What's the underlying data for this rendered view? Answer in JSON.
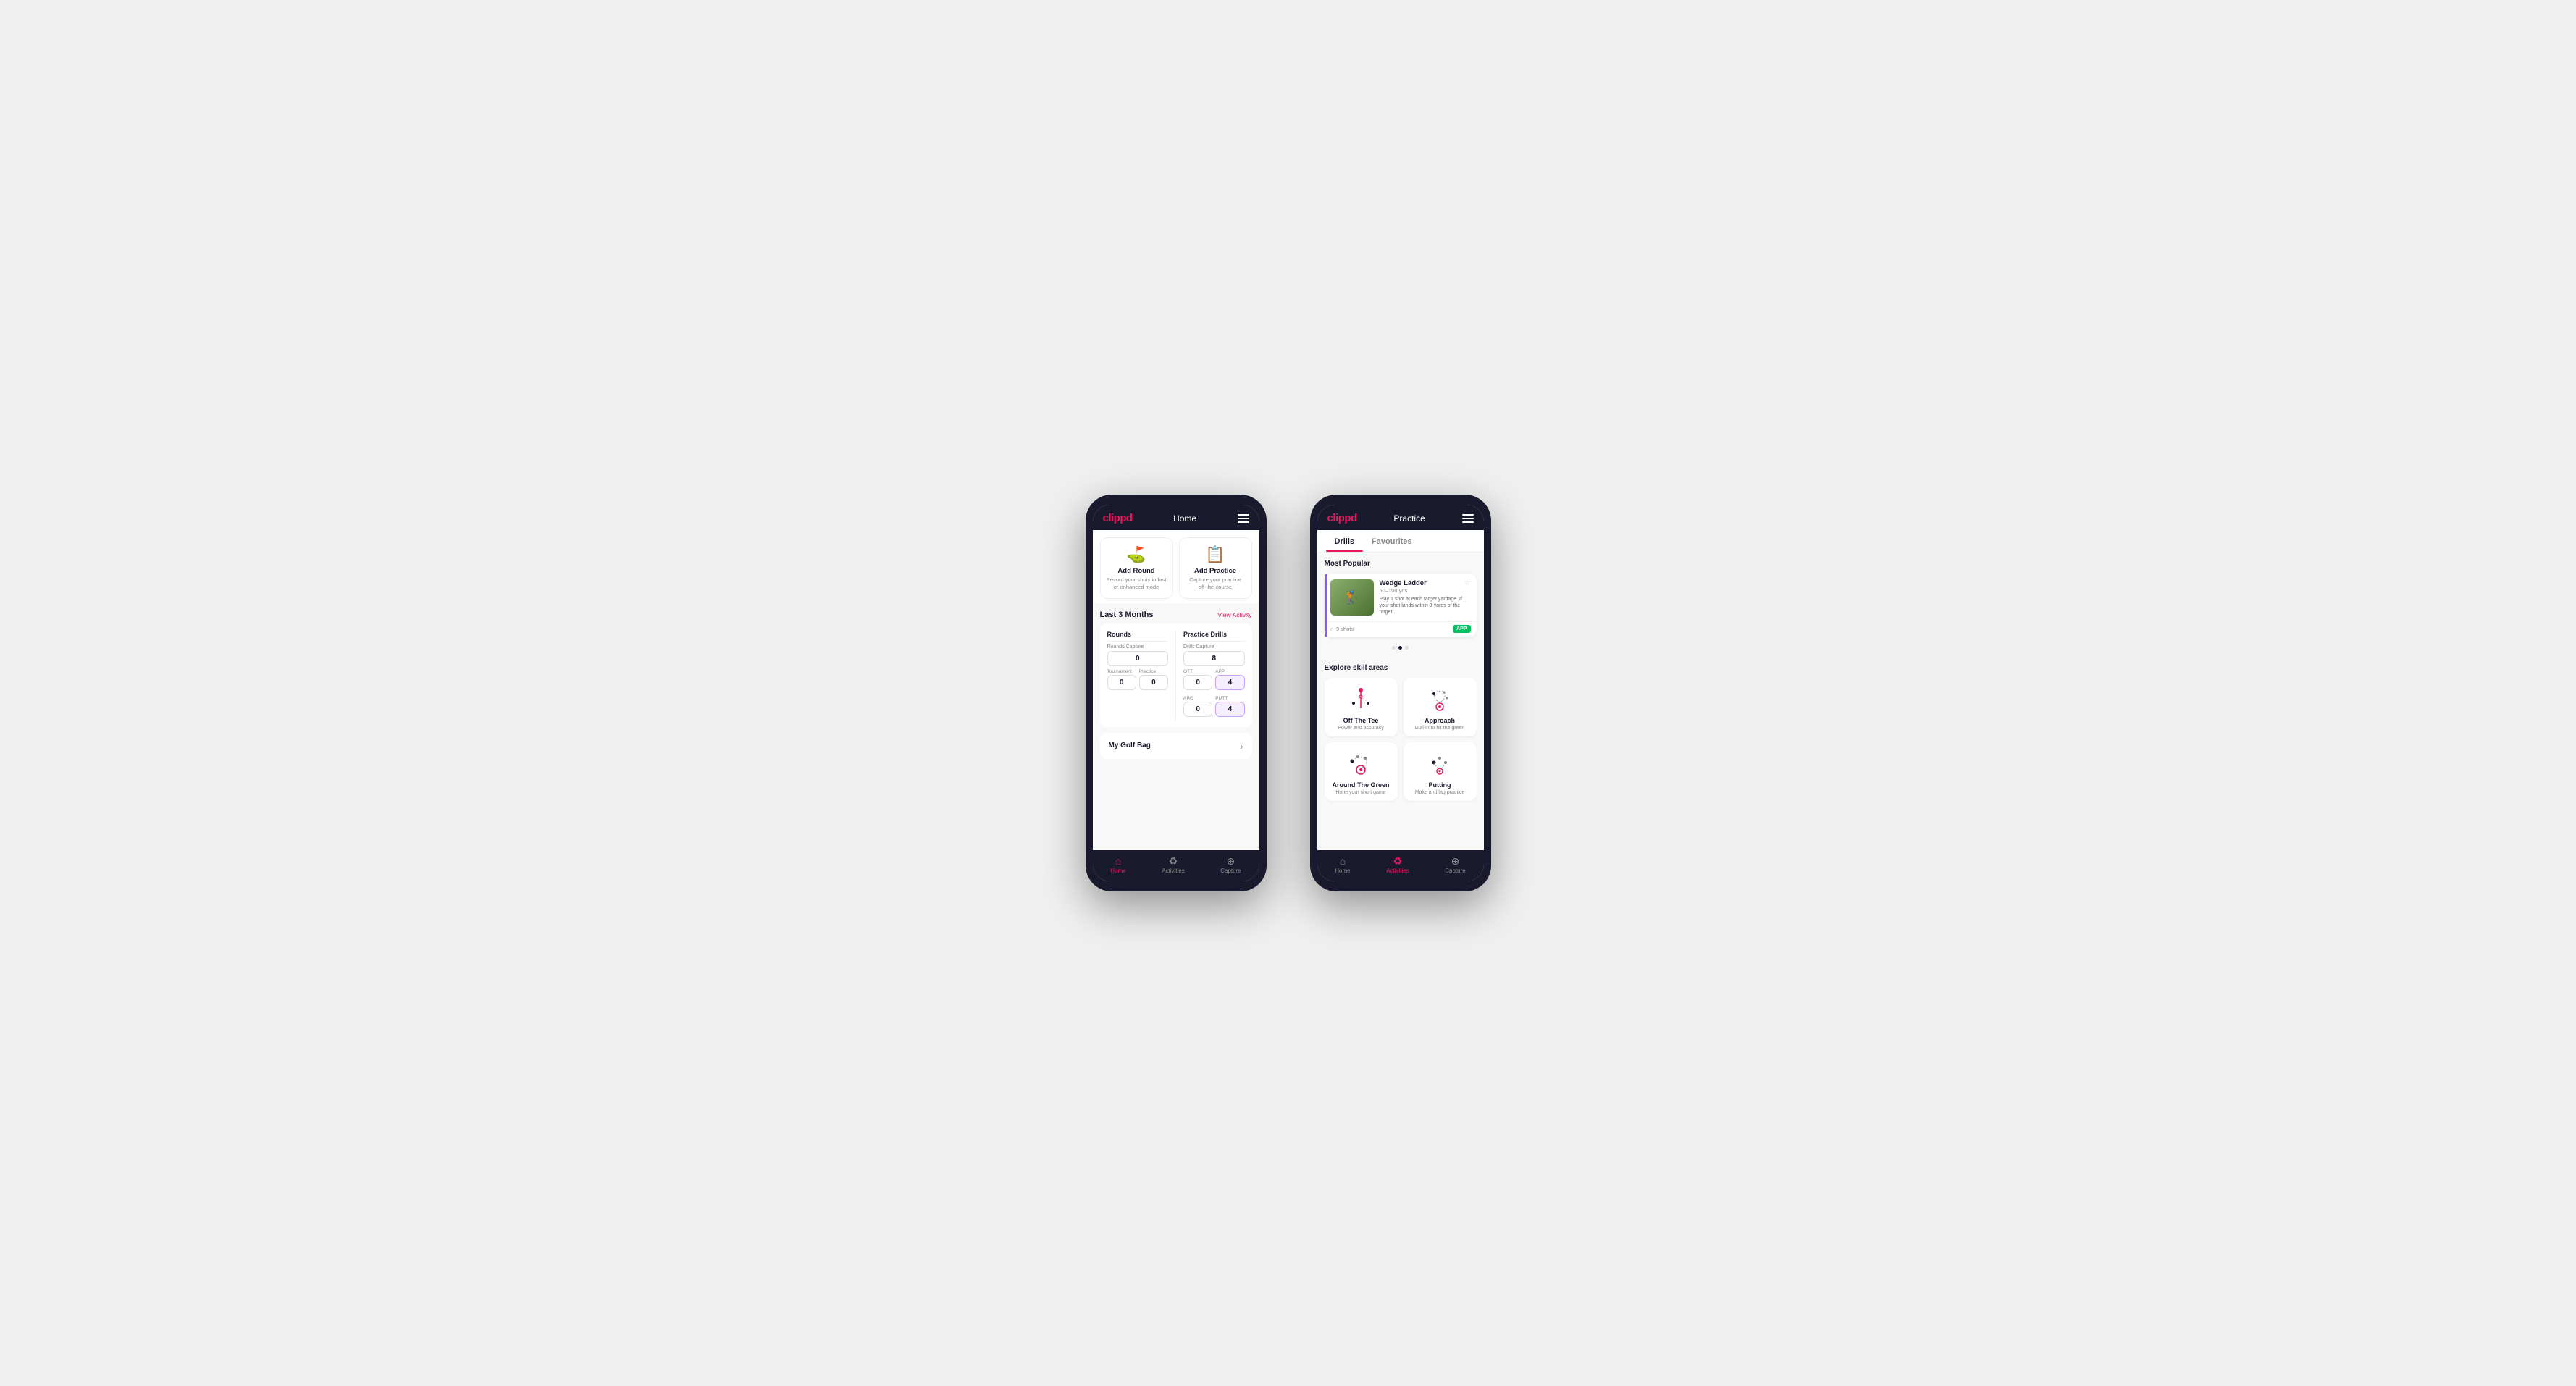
{
  "phone1": {
    "topBar": {
      "logo": "clippd",
      "title": "Home"
    },
    "actionCards": [
      {
        "icon": "⛳",
        "title": "Add Round",
        "desc": "Record your shots in fast or enhanced mode"
      },
      {
        "icon": "📋",
        "title": "Add Practice",
        "desc": "Capture your practice off-the-course"
      }
    ],
    "activitySection": {
      "title": "Last 3 Months",
      "viewLink": "View Activity"
    },
    "rounds": {
      "title": "Rounds",
      "captureLabel": "Rounds Capture",
      "captureValue": "0",
      "tournamentLabel": "Tournament",
      "tournamentValue": "0",
      "practiceLabel": "Practice",
      "practiceValue": "0"
    },
    "practiceDrills": {
      "title": "Practice Drills",
      "captureLabel": "Drills Capture",
      "captureValue": "8",
      "ottLabel": "OTT",
      "ottValue": "0",
      "appLabel": "APP",
      "appValue": "4",
      "argLabel": "ARG",
      "argValue": "0",
      "puttLabel": "PUTT",
      "puttValue": "4"
    },
    "myGolfBag": {
      "label": "My Golf Bag"
    },
    "bottomNav": [
      {
        "label": "Home",
        "active": true
      },
      {
        "label": "Activities",
        "active": false
      },
      {
        "label": "Capture",
        "active": false
      }
    ]
  },
  "phone2": {
    "topBar": {
      "logo": "clippd",
      "title": "Practice"
    },
    "tabs": [
      {
        "label": "Drills",
        "active": true
      },
      {
        "label": "Favourites",
        "active": false
      }
    ],
    "mostPopular": {
      "label": "Most Popular",
      "drill": {
        "title": "Wedge Ladder",
        "yardage": "50–100 yds",
        "desc": "Play 1 shot at each target yardage. If your shot lands within 3 yards of the target...",
        "shots": "9 shots",
        "badge": "APP"
      }
    },
    "dots": [
      false,
      true,
      false
    ],
    "exploreLabel": "Explore skill areas",
    "skills": [
      {
        "title": "Off The Tee",
        "desc": "Power and accuracy",
        "iconType": "tee"
      },
      {
        "title": "Approach",
        "desc": "Dial-in to hit the green",
        "iconType": "approach"
      },
      {
        "title": "Around The Green",
        "desc": "Hone your short game",
        "iconType": "around"
      },
      {
        "title": "Putting",
        "desc": "Make and lag practice",
        "iconType": "putting"
      }
    ],
    "bottomNav": [
      {
        "label": "Home",
        "active": false
      },
      {
        "label": "Activities",
        "active": true
      },
      {
        "label": "Capture",
        "active": false
      }
    ]
  }
}
